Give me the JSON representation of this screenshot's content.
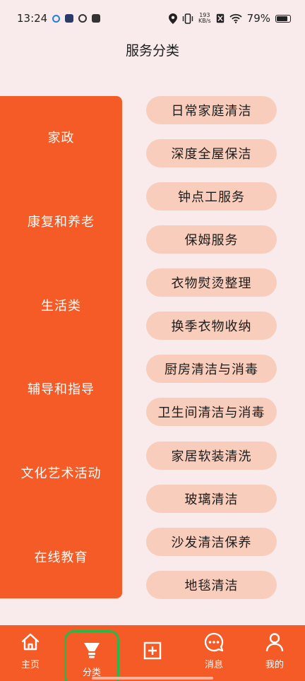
{
  "status_bar": {
    "time": "13:24",
    "net_speed_value": "193",
    "net_speed_unit": "KB/s",
    "battery": "79%"
  },
  "header": {
    "title": "服务分类"
  },
  "categories": [
    {
      "label": "家政"
    },
    {
      "label": "康复和养老"
    },
    {
      "label": "生活类"
    },
    {
      "label": "辅导和指导"
    },
    {
      "label": "文化艺术活动"
    },
    {
      "label": "在线教育"
    }
  ],
  "services": [
    {
      "label": "日常家庭清洁"
    },
    {
      "label": "深度全屋保洁"
    },
    {
      "label": "钟点工服务"
    },
    {
      "label": "保姆服务"
    },
    {
      "label": "衣物熨烫整理"
    },
    {
      "label": "换季衣物收纳"
    },
    {
      "label": "厨房清洁与消毒"
    },
    {
      "label": "卫生间清洁与消毒"
    },
    {
      "label": "家居软装清洗"
    },
    {
      "label": "玻璃清洁"
    },
    {
      "label": "沙发清洁保养"
    },
    {
      "label": "地毯清洁"
    }
  ],
  "nav": {
    "home": {
      "label": "主页",
      "icon": "home-icon"
    },
    "category": {
      "label": "分类",
      "icon": "funnel-icon"
    },
    "add": {
      "label": "",
      "icon": "plus-square-icon"
    },
    "messages": {
      "label": "消息",
      "icon": "chat-bubble-icon"
    },
    "me": {
      "label": "我的",
      "icon": "person-icon"
    }
  },
  "colors": {
    "accent": "#f45b27",
    "pill": "#f9cdbb",
    "background": "#f9ebec",
    "active_outline": "#27b84a"
  }
}
